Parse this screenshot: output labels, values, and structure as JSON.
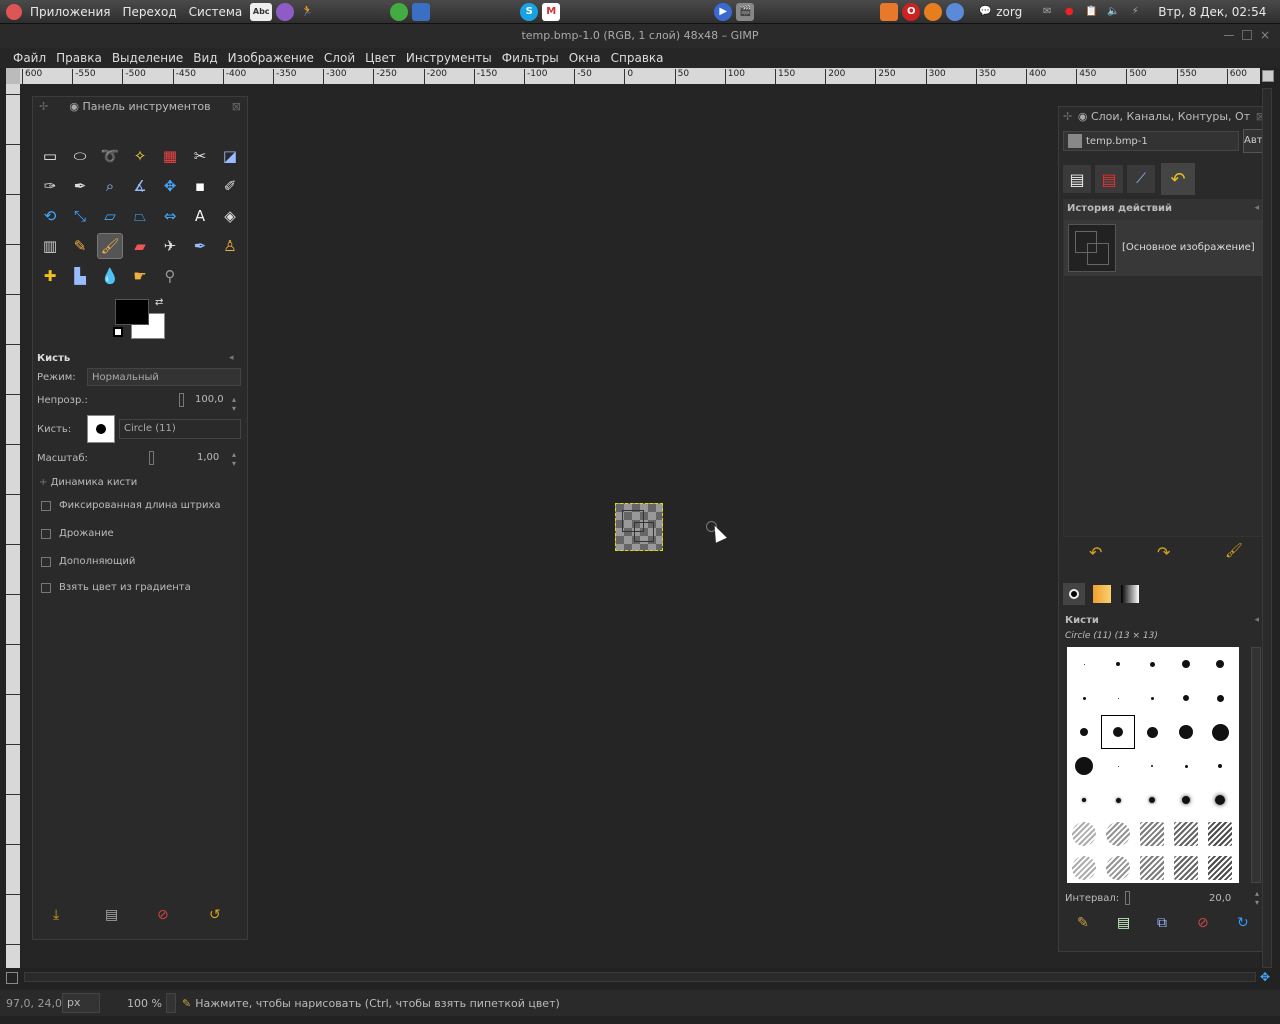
{
  "top_panel": {
    "menus": [
      "Приложения",
      "Переход",
      "Система"
    ],
    "launchers": [
      "spellcheck-icon",
      "web-browser-icon",
      "runner-icon",
      "network-icon",
      "virtualbox-icon",
      "skype-icon",
      "gmail-icon",
      "media-player-icon",
      "video-editor-icon"
    ],
    "tray_icons": [
      "rss-icon",
      "opera-icon",
      "firefox-icon",
      "chrome-icon"
    ],
    "user": "zorg",
    "clock": "Втр, 8 Дек, 02:54"
  },
  "window": {
    "title": "temp.bmp-1.0 (RGB, 1 слой) 48x48 – GIMP"
  },
  "menubar": {
    "items": [
      "Файл",
      "Правка",
      "Выделение",
      "Вид",
      "Изображение",
      "Слой",
      "Цвет",
      "Инструменты",
      "Фильтры",
      "Окна",
      "Справка"
    ]
  },
  "ruler": {
    "h_ticks": [
      "600",
      "-550",
      "-500",
      "-450",
      "-400",
      "-350",
      "-300",
      "-250",
      "-200",
      "-150",
      "-100",
      "-50",
      "0",
      "50",
      "100",
      "150",
      "200",
      "250",
      "300",
      "350",
      "400",
      "450",
      "500",
      "550",
      "600"
    ]
  },
  "toolbox": {
    "title": "Панель инструментов",
    "tool_options_title": "Кисть",
    "mode_label": "Режим:",
    "mode_value": "Нормальный",
    "opacity_label": "Непрозр.:",
    "opacity_value": "100,0",
    "brush_label": "Кисть:",
    "brush_value": "Circle (11)",
    "scale_label": "Масштаб:",
    "scale_value": "1,00",
    "dynamics_label": "Динамика кисти",
    "options": [
      "Фиксированная длина штриха",
      "Дрожание",
      "Дополняющий",
      "Взять цвет из градиента"
    ]
  },
  "dock": {
    "title": "Слои, Каналы, Контуры, От",
    "image_name": "temp.bmp-1",
    "auto_button": "Авто",
    "history_title": "История действий",
    "history_items": [
      "[Основное изображение]"
    ],
    "brushes_title": "Кисти",
    "brush_selected": "Circle (11) (13 × 13)",
    "interval_label": "Интервал:",
    "interval_value": "20,0"
  },
  "status": {
    "coords": "97,0, 24,0",
    "unit": "px",
    "zoom": "100 %",
    "message": "Нажмите, чтобы нарисовать (Ctrl, чтобы взять пипеткой цвет)"
  },
  "colors": {
    "foreground": "#000000",
    "background": "#ffffff",
    "accent": "#d6a21e"
  }
}
